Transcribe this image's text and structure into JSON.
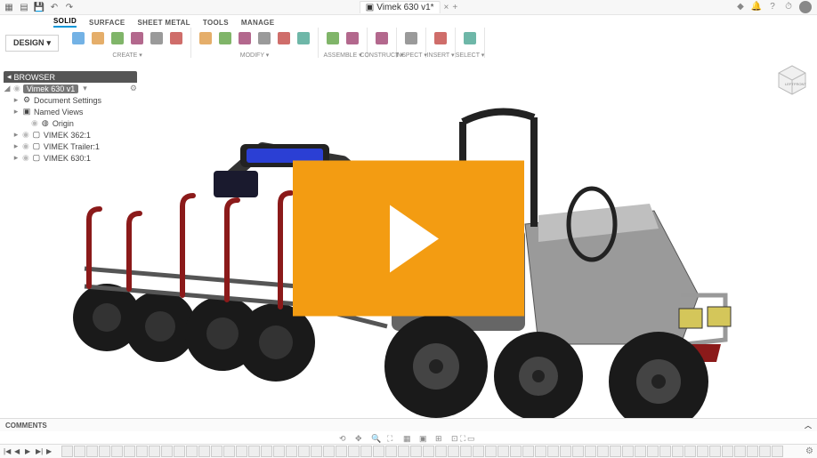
{
  "titlebar": {
    "tab_icon": "▣",
    "tab_label": "Vimek 630 v1*",
    "close": "×",
    "add": "+"
  },
  "menubar": {
    "tabs": [
      "SOLID",
      "SURFACE",
      "SHEET METAL",
      "TOOLS",
      "MANAGE"
    ],
    "active": 0
  },
  "designBtn": {
    "label": "DESIGN",
    "caret": "▾"
  },
  "toolGroups": [
    {
      "label": "CREATE ▾",
      "n": 6
    },
    {
      "label": "MODIFY ▾",
      "n": 6
    },
    {
      "label": "ASSEMBLE ▾",
      "n": 2
    },
    {
      "label": "CONSTRUCT ▾",
      "n": 1
    },
    {
      "label": "INSPECT ▾",
      "n": 1
    },
    {
      "label": "INSERT ▾",
      "n": 1
    },
    {
      "label": "SELECT ▾",
      "n": 1
    }
  ],
  "browser": {
    "title": "BROWSER",
    "root": "Vimek 630 v1",
    "items": [
      {
        "indent": 1,
        "arrow": "▸",
        "ico": "⚙",
        "label": "Document Settings"
      },
      {
        "indent": 1,
        "arrow": "▸",
        "ico": "▣",
        "label": "Named Views"
      },
      {
        "indent": 2,
        "arrow": "",
        "ico": "◍",
        "label": "Origin",
        "vis": true
      },
      {
        "indent": 1,
        "arrow": "▸",
        "ico": "▢",
        "label": "VIMEK 362:1",
        "vis": true
      },
      {
        "indent": 1,
        "arrow": "▸",
        "ico": "▢",
        "label": "VIMEK Trailer:1",
        "vis": true
      },
      {
        "indent": 1,
        "arrow": "▸",
        "ico": "▢",
        "label": "VIMEK 630:1",
        "vis": true
      }
    ]
  },
  "comments": {
    "label": "COMMENTS",
    "chev": "︿"
  },
  "viewcube": {
    "front": "FRONT",
    "left": "LEFT"
  },
  "timeline": {
    "controls": [
      "|◀",
      "◀",
      "▶",
      "▶|",
      "▶"
    ],
    "count": 58
  }
}
